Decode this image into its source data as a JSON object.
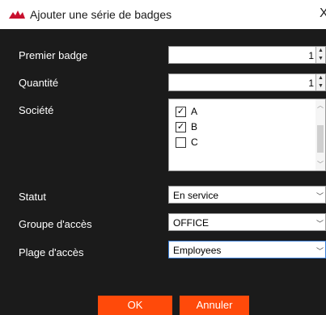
{
  "dialog": {
    "title": "Ajouter une série de badges",
    "close_symbol": "X"
  },
  "form": {
    "first_badge": {
      "label": "Premier badge",
      "value": "1"
    },
    "quantity": {
      "label": "Quantité",
      "value": "1"
    },
    "company": {
      "label": "Société",
      "options": [
        {
          "label": "A",
          "checked": true
        },
        {
          "label": "B",
          "checked": true
        },
        {
          "label": "C",
          "checked": false
        }
      ]
    },
    "status": {
      "label": "Statut",
      "selected": "En service"
    },
    "access_group": {
      "label": "Groupe d'accès",
      "selected": "OFFICE"
    },
    "access_range": {
      "label": "Plage d'accès",
      "selected": "Employees"
    }
  },
  "buttons": {
    "ok": "OK",
    "cancel": "Annuler"
  },
  "colors": {
    "background": "#1b1b1b",
    "accent": "#ff4a0a",
    "focus": "#3c7fd6"
  },
  "icons": {
    "app": "red-bird-logo-icon",
    "close": "close-icon",
    "spin_up": "chevron-up-icon",
    "spin_down": "chevron-down-icon",
    "dropdown": "chevron-down-icon",
    "checkbox": "checkmark-icon"
  }
}
